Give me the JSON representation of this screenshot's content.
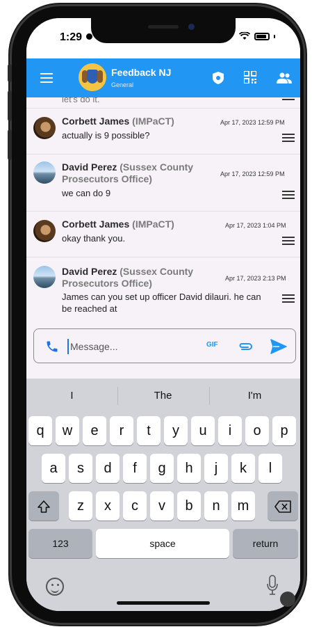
{
  "status_bar": {
    "time": "1:29"
  },
  "app_bar": {
    "title": "Feedback NJ",
    "subtitle": "General"
  },
  "messages": [
    {
      "sender": "",
      "org": "",
      "time": "",
      "text": "let's do it."
    },
    {
      "sender": "Corbett James",
      "org": "(IMPaCT)",
      "time": "Apr 17, 2023 12:59 PM",
      "text": "actually is 9 possible?"
    },
    {
      "sender": "David Perez",
      "org": "(Sussex County Prosecutors Office)",
      "time": "Apr 17, 2023 12:59 PM",
      "text": "we can do 9"
    },
    {
      "sender": "Corbett James",
      "org": "(IMPaCT)",
      "time": "Apr 17, 2023 1:04 PM",
      "text": "okay thank you."
    },
    {
      "sender": "David Perez",
      "org": "(Sussex County Prosecutors Office)",
      "time": "Apr 17, 2023 2:13 PM",
      "text": "James can you set up officer David dilauri. he can be reached at"
    }
  ],
  "input": {
    "placeholder": "Message...",
    "gif_label": "GIF"
  },
  "keyboard": {
    "suggestions": [
      "I",
      "The",
      "I'm"
    ],
    "row1": [
      "q",
      "w",
      "e",
      "r",
      "t",
      "y",
      "u",
      "i",
      "o",
      "p"
    ],
    "row2": [
      "a",
      "s",
      "d",
      "f",
      "g",
      "h",
      "j",
      "k",
      "l"
    ],
    "row3": [
      "z",
      "x",
      "c",
      "v",
      "b",
      "n",
      "m"
    ],
    "numbers_label": "123",
    "space_label": "space",
    "return_label": "return"
  }
}
